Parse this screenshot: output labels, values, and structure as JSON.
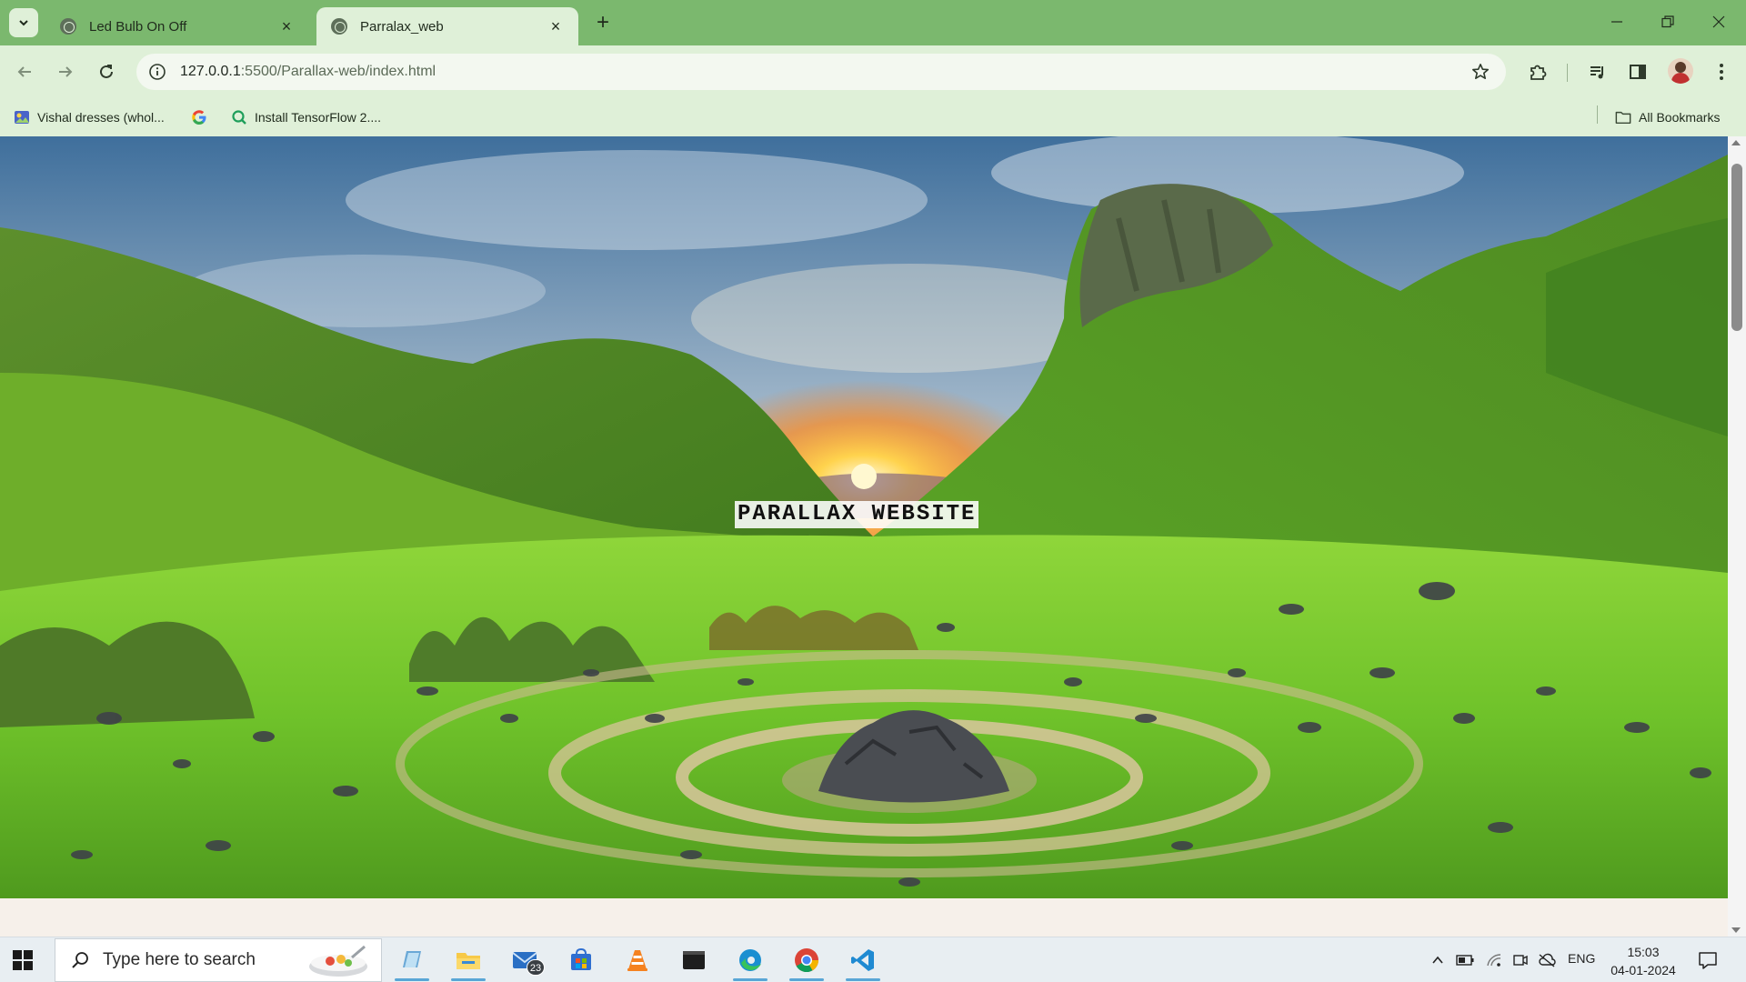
{
  "browser": {
    "tabs": [
      {
        "title": "Led Bulb On Off",
        "active": false
      },
      {
        "title": "Parralax_web",
        "active": true
      }
    ],
    "address": {
      "host": "127.0.0.1",
      "rest": ":5500/Parallax-web/index.html"
    },
    "bookmarks": [
      {
        "label": "Vishal dresses (whol...",
        "icon": "bookmark-favicon"
      },
      {
        "label": "",
        "icon": "google-icon"
      },
      {
        "label": "Install TensorFlow 2....",
        "icon": "tensorflow-favicon"
      }
    ],
    "all_bookmarks_label": "All Bookmarks"
  },
  "page": {
    "hero_title": "PARALLAX WEBSITE"
  },
  "taskbar": {
    "search_placeholder": "Type here to search",
    "mail_badge": "23",
    "language": "ENG",
    "time": "15:03",
    "date": "04-01-2024",
    "apps": [
      "file-explorer-icon",
      "mail-icon",
      "store-icon",
      "vlc-icon",
      "terminal-icon",
      "edge-icon",
      "chrome-icon",
      "vscode-icon"
    ]
  },
  "colors": {
    "tabbar": "#7bb86e",
    "toolbar": "#dff0d8",
    "taskbar": "#e8eef2"
  }
}
